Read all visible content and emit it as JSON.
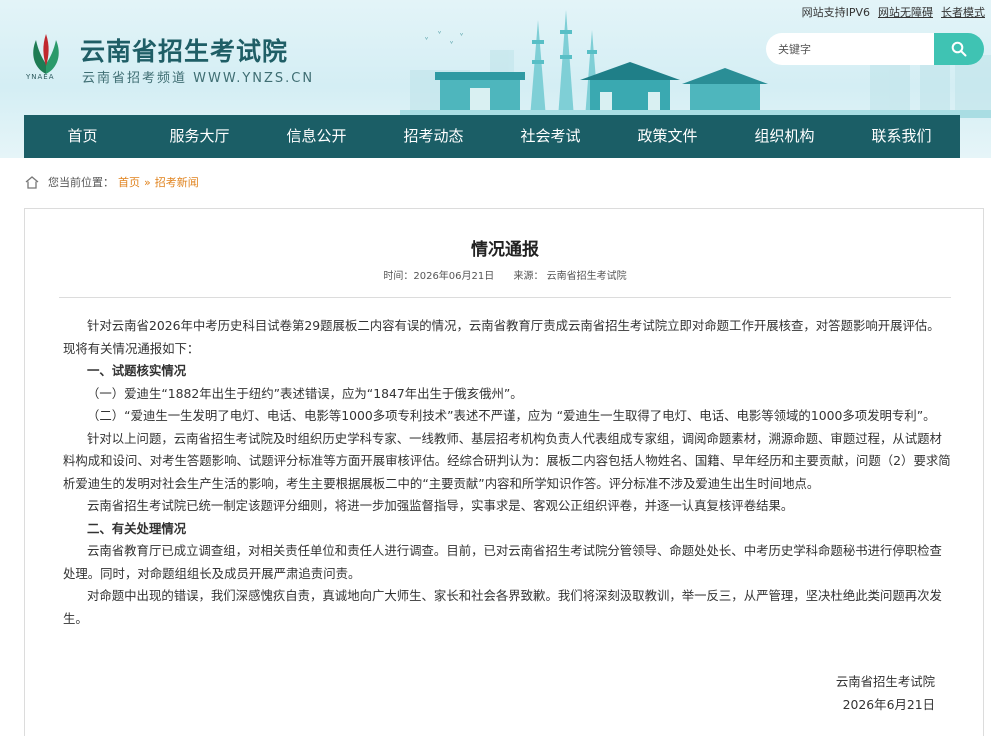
{
  "topbar": {
    "ipv6": "网站支持IPV6",
    "accessibility": "网站无障碍",
    "elder_mode": "长者模式"
  },
  "header": {
    "logo_text": "YNAEA",
    "site_title": "云南省招生考试院",
    "site_subtitle": "云南省招考频道 WWW.YNZS.CN"
  },
  "search": {
    "placeholder": "关键字"
  },
  "nav": {
    "items": [
      "首页",
      "服务大厅",
      "信息公开",
      "招考动态",
      "社会考试",
      "政策文件",
      "组织机构",
      "联系我们"
    ]
  },
  "breadcrumb": {
    "label": "您当前位置：",
    "home": "首页",
    "separator": "»",
    "current": "招考新闻"
  },
  "article": {
    "title": "情况通报",
    "time_label": "时间：2026年06月21日",
    "source_label": "来源：  云南省招生考试院",
    "paragraphs": [
      "针对云南省2026年中考历史科目试卷第29题展板二内容有误的情况，云南省教育厅责成云南省招生考试院立即对命题工作开展核查，对答题影响开展评估。现将有关情况通报如下：",
      "一、试题核实情况",
      "（一）爱迪生“1882年出生于纽约”表述错误，应为“1847年出生于俄亥俄州”。",
      "（二）“爱迪生一生发明了电灯、电话、电影等1000多项专利技术”表述不严谨，应为 “爱迪生一生取得了电灯、电话、电影等领域的1000多项发明专利”。",
      "针对以上问题，云南省招生考试院及时组织历史学科专家、一线教师、基层招考机构负责人代表组成专家组，调阅命题素材，溯源命题、审题过程，从试题材料构成和设问、对考生答题影响、试题评分标准等方面开展审核评估。经综合研判认为：展板二内容包括人物姓名、国籍、早年经历和主要贡献，问题（2）要求简析爱迪生的发明对社会生产生活的影响，考生主要根据展板二中的“主要贡献”内容和所学知识作答。评分标准不涉及爱迪生出生时间地点。",
      "云南省招生考试院已统一制定该题评分细则，将进一步加强监督指导，实事求是、客观公正组织评卷，并逐一认真复核评卷结果。",
      "二、有关处理情况",
      "云南省教育厅已成立调查组，对相关责任单位和责任人进行调查。目前，已对云南省招生考试院分管领导、命题处处长、中考历史学科命题秘书进行停职检查处理。同时，对命题组组长及成员开展严肃追责问责。",
      "对命题中出现的错误，我们深感愧疚自责，真诚地向广大师生、家长和社会各界致歉。我们将深刻汲取教训，举一反三，从严管理，坚决杜绝此类问题再次发生。"
    ],
    "signature": "云南省招生考试院",
    "date": "2026年6月21日"
  },
  "colors": {
    "nav_bg": "#1b5e66",
    "accent_teal": "#3fc3b3",
    "breadcrumb_link": "#e0831e",
    "title_teal": "#1f5e66"
  }
}
